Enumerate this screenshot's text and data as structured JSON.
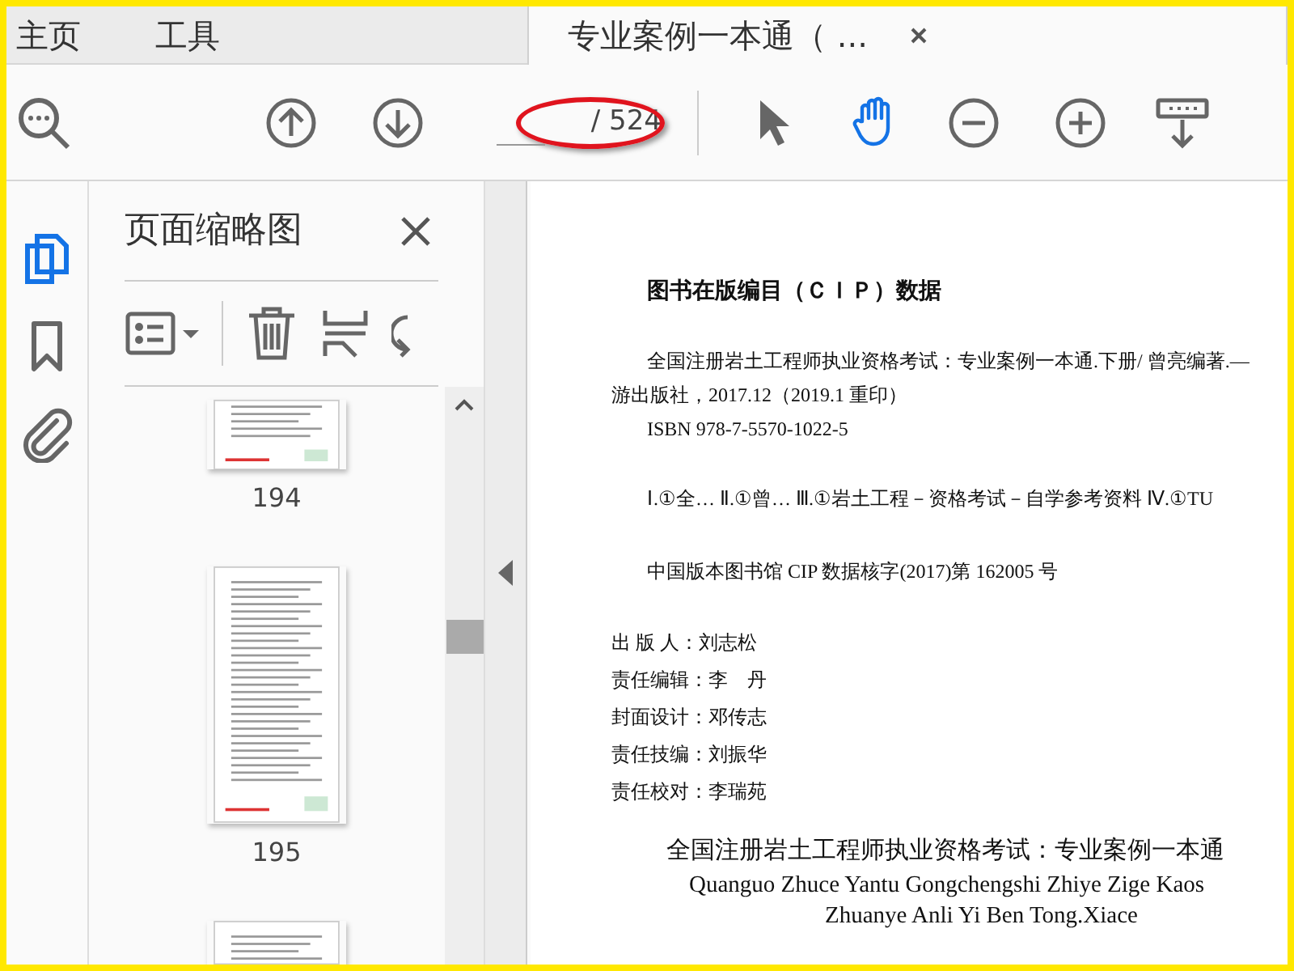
{
  "tabs": [
    {
      "label": "主页",
      "selected": false
    },
    {
      "label": "工具",
      "selected": false
    },
    {
      "label": "专业案例一本通（ ...",
      "selected": true,
      "closable": true
    }
  ],
  "toolbar": {
    "page_total": "/ 524",
    "highlighted": true,
    "tools": [
      {
        "kind": "select",
        "selected": false
      },
      {
        "kind": "hand",
        "selected": true
      },
      {
        "kind": "zoom-out",
        "selected": false
      },
      {
        "kind": "zoom-in",
        "selected": false
      },
      {
        "kind": "fit",
        "selected": false
      }
    ]
  },
  "side_rail": [
    {
      "kind": "pages",
      "selected": true
    },
    {
      "kind": "bookmark",
      "selected": false
    },
    {
      "kind": "attachment",
      "selected": false
    }
  ],
  "thumbnail_panel": {
    "title": "页面缩略图",
    "thumbnails": [
      {
        "label": "194",
        "kind": "bottom"
      },
      {
        "label": "195",
        "kind": "full"
      },
      {
        "kind": "top"
      }
    ]
  },
  "document": {
    "heading": "图书在版编目（ＣＩＰ）数据",
    "lines": [
      "全国注册岩土工程师执业资格考试：专业案例一本通.下册/ 曾亮编著.—",
      "游出版社，2017.12（2019.1 重印）",
      "ISBN 978-7-5570-1022-5"
    ],
    "classification": "Ⅰ.①全… Ⅱ.①曾… Ⅲ.①岩土工程－资格考试－自学参考资料 Ⅳ.①TU",
    "cip_number": "中国版本图书馆 CIP 数据核字(2017)第 162005 号",
    "credits": [
      {
        "role": "出 版 人：",
        "name": "刘志松"
      },
      {
        "role": "责任编辑：",
        "name": "李　丹"
      },
      {
        "role": "封面设计：",
        "name": "邓传志"
      },
      {
        "role": "责任技编：",
        "name": "刘振华"
      },
      {
        "role": "责任校对：",
        "name": "李瑞苑"
      }
    ],
    "book_title": "全国注册岩土工程师执业资格考试：专业案例一本通",
    "pinyin": [
      "Quanguo Zhuce Yantu Gongchengshi Zhiye Zige Kaos",
      "Zhuanye Anli Yi Ben Tong.Xiace"
    ]
  }
}
